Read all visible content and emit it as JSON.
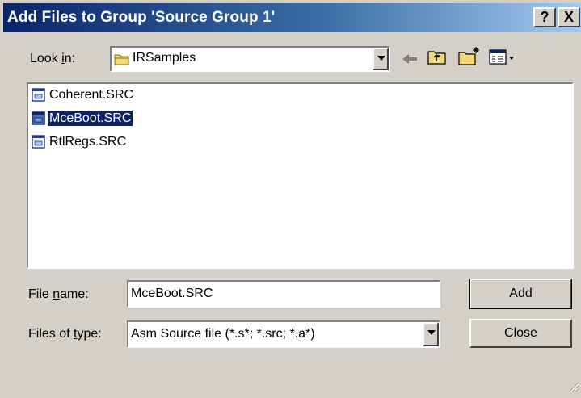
{
  "window": {
    "title": "Add Files to Group 'Source Group 1'",
    "help_label": "?",
    "close_label": "X"
  },
  "lookin": {
    "label_prefix": "Look ",
    "label_accel": "i",
    "label_suffix": "n:",
    "folder": "IRSamples"
  },
  "toolbar": {
    "icons": [
      "back-arrow-icon",
      "up-folder-icon",
      "new-folder-icon",
      "view-menu-icon"
    ]
  },
  "files": [
    {
      "name": "Coherent.SRC",
      "selected": false
    },
    {
      "name": "MceBoot.SRC",
      "selected": true
    },
    {
      "name": "RtlRegs.SRC",
      "selected": false
    }
  ],
  "filename": {
    "label_prefix": "File ",
    "label_accel": "n",
    "label_suffix": "ame:",
    "value": "MceBoot.SRC"
  },
  "filetype": {
    "label_prefix": "Files of ",
    "label_accel": "t",
    "label_suffix": "ype:",
    "value": "Asm Source file (*.s*; *.src; *.a*)"
  },
  "buttons": {
    "add": "Add",
    "close": "Close"
  },
  "colors": {
    "title_start": "#0a246a",
    "title_end": "#a6caf0",
    "selection": "#0a246a",
    "face": "#d4d0c8"
  }
}
